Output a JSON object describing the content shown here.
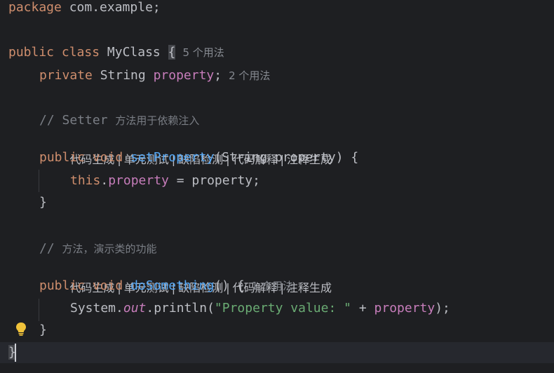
{
  "code": {
    "l1": {
      "kw": "package",
      "rest": " com.example;"
    },
    "l2": {
      "kw1": "public",
      "kw2": "class",
      "name": " MyClass ",
      "brace": "{",
      "hint": "5 个用法"
    },
    "l3": {
      "kw": "private",
      "type": " String ",
      "field": "property",
      "end": ";",
      "hint": "2 个用法"
    },
    "l4": {
      "comment": "// Setter",
      "comment_cn": "方法用于依赖注入"
    },
    "l5": {
      "kw1": "public",
      "kw2": "void",
      "fn": "setProperty",
      "params": "(String property) {"
    },
    "l6": {
      "this": "this",
      "dot": ".",
      "field": "property",
      "rest": " = property;"
    },
    "l7": {
      "close": "}"
    },
    "l8": {
      "comment": "//",
      "comment_cn": "方法，演示类的功能"
    },
    "l9": {
      "kw1": "public",
      "kw2": "void",
      "fn": "doSomething",
      "params": "() {",
      "hint": "1 个用法"
    },
    "l10": {
      "cls": "System.",
      "static": "out",
      "call": ".println(",
      "str": "\"Property value: \"",
      "plus": " + ",
      "field": "property",
      "end": ");"
    },
    "l11": {
      "close": "}"
    },
    "l12": {
      "close": "}"
    }
  },
  "code_lens": {
    "actions": [
      "代码生成",
      "单元测试",
      "缺陷检测",
      "代码解释",
      "注释生成"
    ],
    "separator": "|"
  },
  "icons": {
    "bulb": "lightbulb-icon"
  },
  "colors": {
    "background": "#1e1f22",
    "keyword": "#cf8e6d",
    "field": "#c77dbb",
    "function": "#56a8f5",
    "string": "#6aab73",
    "comment": "#7a7e85",
    "text": "#bcbec4"
  }
}
